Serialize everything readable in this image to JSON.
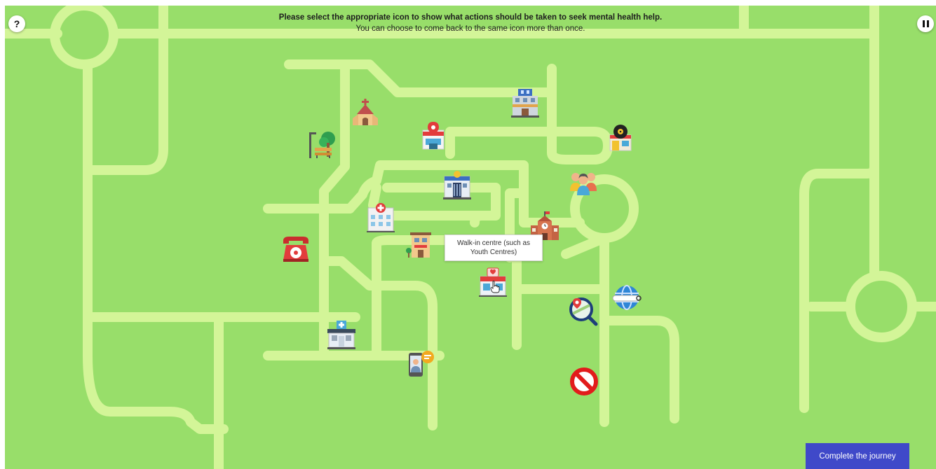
{
  "instructions": {
    "line1": "Please select the appropriate icon to show what actions should be taken to seek mental health help.",
    "line2": "You can choose to come back to the same icon more than once."
  },
  "controls": {
    "help_glyph": "?",
    "pause_icon": "pause-icon"
  },
  "tooltip": {
    "text": "Walk-in centre (such as Youth Centres)"
  },
  "complete_button": {
    "label": "Complete the journey"
  },
  "icons": [
    "church-icon",
    "park-bench-tree-icon",
    "pharmacy-icon",
    "office-tower-icon",
    "record-shop-icon",
    "police-station-icon",
    "people-group-icon",
    "hospital-icon",
    "school-icon",
    "telephone-icon",
    "house-icon",
    "walk-in-centre-icon",
    "map-search-icon",
    "web-search-globe-icon",
    "clinic-icon",
    "video-chat-phone-icon",
    "no-entry-icon"
  ],
  "colors": {
    "grass": "#98de6a",
    "road": "#d3f598",
    "button": "#3f49c9"
  }
}
